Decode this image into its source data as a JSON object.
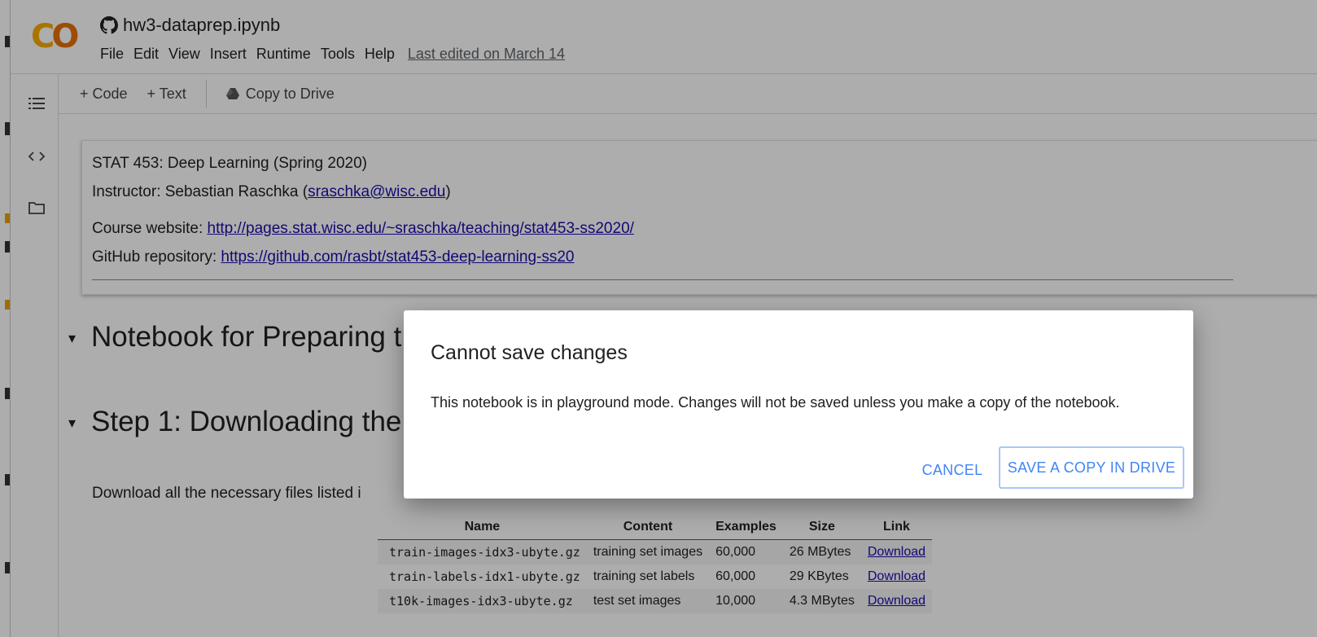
{
  "header": {
    "notebook_title": "hw3-dataprep.ipynb",
    "menu": [
      "File",
      "Edit",
      "View",
      "Insert",
      "Runtime",
      "Tools",
      "Help"
    ],
    "last_edited": "Last edited on March 14"
  },
  "toolbar": {
    "add_code": "+ Code",
    "add_text": "+ Text",
    "copy_to_drive": "Copy to Drive"
  },
  "cell": {
    "line1": "STAT 453: Deep Learning (Spring 2020)",
    "instructor_prefix": "Instructor: Sebastian Raschka (",
    "instructor_email": "sraschka@wisc.edu",
    "instructor_suffix": ")",
    "website_prefix": "Course website: ",
    "website_url": "http://pages.stat.wisc.edu/~sraschka/teaching/stat453-ss2020/",
    "github_prefix": "GitHub repository: ",
    "github_url": "https://github.com/rasbt/stat453-deep-learning-ss20"
  },
  "headings": {
    "h1": "Notebook for Preparing t",
    "h2": "Step 1: Downloading the es"
  },
  "intro_text": "Download all the necessary files listed i",
  "table": {
    "headers": [
      "Name",
      "Content",
      "Examples",
      "Size",
      "Link"
    ],
    "rows": [
      [
        "train-images-idx3-ubyte.gz",
        "training set images",
        "60,000",
        "26 MBytes",
        "Download"
      ],
      [
        "train-labels-idx1-ubyte.gz",
        "training set labels",
        "60,000",
        "29 KBytes",
        "Download"
      ],
      [
        "t10k-images-idx3-ubyte.gz",
        "test set images",
        "10,000",
        "4.3 MBytes",
        "Download"
      ]
    ]
  },
  "dialog": {
    "title": "Cannot save changes",
    "message": "This notebook is in playground mode. Changes will not be saved unless you make a copy of the notebook.",
    "cancel": "CANCEL",
    "save_copy": "SAVE A COPY IN DRIVE"
  },
  "colors": {
    "accent": "#4285f4",
    "link": "#1a0dab",
    "logo_yellow": "#f9ab00",
    "logo_orange": "#e8710a"
  },
  "icons": [
    "github-icon",
    "table-of-contents-icon",
    "code-snippets-icon",
    "files-folder-icon",
    "drive-icon",
    "chevron-down-icon"
  ]
}
